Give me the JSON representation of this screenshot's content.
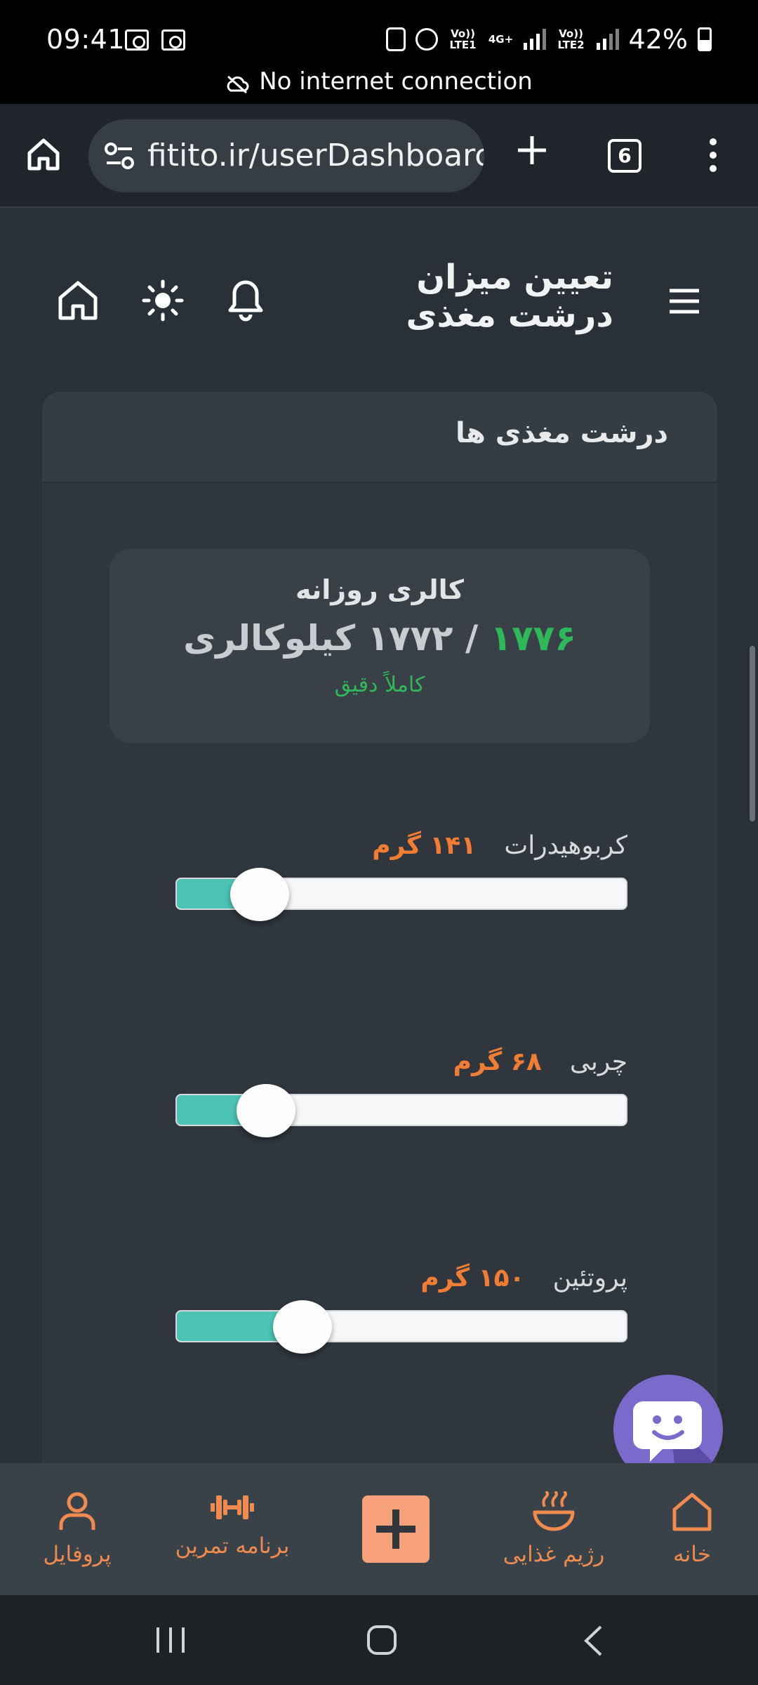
{
  "status_bar": {
    "time": "09:41",
    "battery": "42%",
    "sim1": "Vo)) LTE1",
    "sim2": "Vo)) LTE2",
    "network": "4G+",
    "notice": "No internet connection"
  },
  "browser": {
    "url": "fitito.ir/userDashboarc",
    "tab_count": "6"
  },
  "header": {
    "title": "تعیین میزان درشت مغذی"
  },
  "card": {
    "title": "درشت مغذی ها",
    "calorie": {
      "label": "کالری روزانه",
      "current": "۱۷۷۶",
      "separator": " / ",
      "target": "۱۷۷۲ کیلوکالری",
      "status": "کاملاً دقیق"
    },
    "macros": [
      {
        "name": "کربوهیدرات",
        "value": "۱۴۱ گرم",
        "level": 0.185
      },
      {
        "name": "چربی",
        "value": "۶۸ گرم",
        "level": 0.198
      },
      {
        "name": "پروتئین",
        "value": "۱۵۰ گرم",
        "level": 0.28
      }
    ]
  },
  "bottom_nav": {
    "home": "خانه",
    "diet": "رژیم غذایی",
    "workout": "برنامه تمرین",
    "profile": "پروفایل"
  },
  "colors": {
    "accent_orange": "#f07d33",
    "accent_green": "#2fb85a",
    "slider_fill": "#4cc3b5",
    "chat_purple": "#7b6acb"
  }
}
